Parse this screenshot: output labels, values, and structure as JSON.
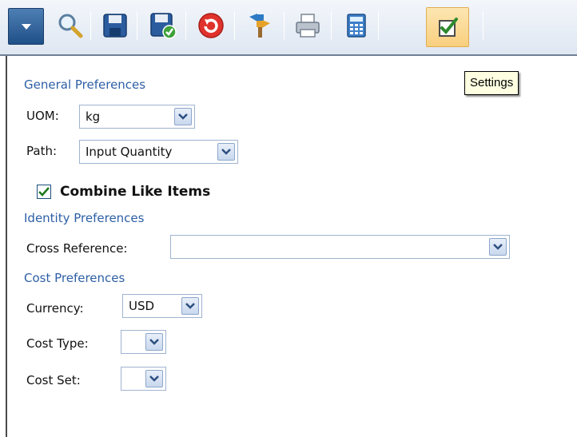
{
  "toolbar": {
    "buttons": [
      {
        "icon": "menu-dropdown-icon"
      },
      {
        "icon": "search-icon"
      },
      {
        "icon": "save-icon"
      },
      {
        "icon": "save-and-validate-icon"
      },
      {
        "icon": "undo-icon"
      },
      {
        "icon": "signpost-icon"
      },
      {
        "icon": "print-icon"
      },
      {
        "icon": "calculator-icon"
      },
      {
        "icon": "settings-icon",
        "active": true
      }
    ],
    "tooltip": "Settings"
  },
  "form": {
    "general": {
      "heading": "General Preferences",
      "uom_label": "UOM:",
      "uom_value": "kg",
      "path_label": "Path:",
      "path_value": "Input Quantity",
      "combine_label": "Combine Like Items",
      "combine_checked": true
    },
    "identity": {
      "heading": "Identity Preferences",
      "cross_ref_label": "Cross Reference:",
      "cross_ref_value": ""
    },
    "cost": {
      "heading": "Cost Preferences",
      "currency_label": "Currency:",
      "currency_value": "USD",
      "cost_type_label": "Cost Type:",
      "cost_type_value": "",
      "cost_set_label": "Cost Set:",
      "cost_set_value": ""
    }
  },
  "colors": {
    "section_heading": "#2d5fa6",
    "toolbar_active": "#f9cf7e",
    "menu_button": "#1f4f88"
  }
}
